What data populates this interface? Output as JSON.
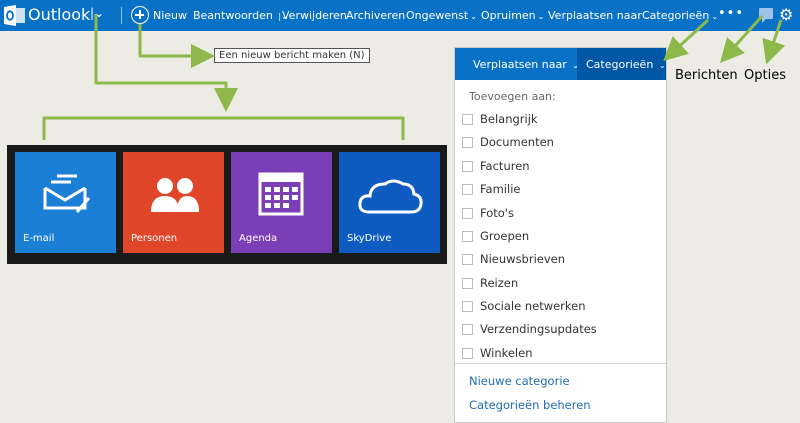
{
  "app": {
    "brand": "Outlook"
  },
  "toolbar": {
    "new_label": "Nieuw",
    "commands": [
      {
        "label": "Beantwoorden",
        "chevron": "|",
        "x": 0
      },
      {
        "label": "Verwijderen"
      },
      {
        "label": "Archiveren"
      },
      {
        "label": "Ongewenst"
      },
      {
        "label": "Opruimen"
      },
      {
        "label": "Verplaatsen naar"
      },
      {
        "label": "Categorieën"
      }
    ],
    "more": "•••"
  },
  "tooltip": "Een nieuw bericht maken (N)",
  "tiles": [
    {
      "label": "E-mail",
      "color": "#1b7fd6",
      "icon": "mail-icon"
    },
    {
      "label": "Personen",
      "color": "#e0472a",
      "icon": "people-icon"
    },
    {
      "label": "Agenda",
      "color": "#7a3fb7",
      "icon": "calendar-icon"
    },
    {
      "label": "SkyDrive",
      "color": "#0f5cc1",
      "icon": "cloud-icon"
    }
  ],
  "panel": {
    "move_label": "Verplaatsen naar",
    "categories_label": "Categorieën",
    "add_to": "Toevoegen aan:",
    "categories": [
      "Belangrijk",
      "Documenten",
      "Facturen",
      "Familie",
      "Foto's",
      "Groepen",
      "Nieuwsbrieven",
      "Reizen",
      "Sociale netwerken",
      "Verzendingsupdates",
      "Winkelen"
    ],
    "links": [
      "Nieuwe categorie",
      "Categorieën beheren"
    ]
  },
  "annotations": {
    "berichten": "Berichten",
    "opties": "Opties"
  },
  "colors": {
    "topbar": "#0a72c6",
    "arrow": "#8db84a",
    "background": "#ecebe4"
  }
}
